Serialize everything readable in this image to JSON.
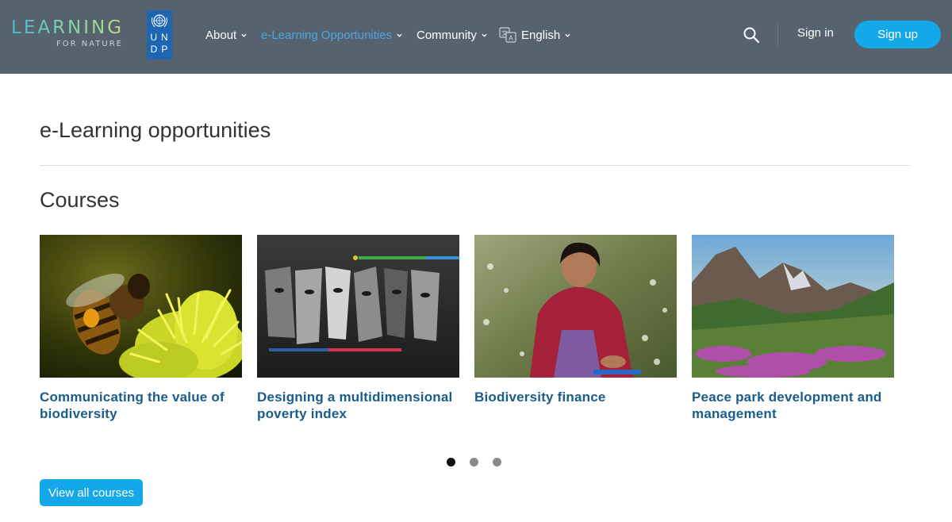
{
  "header": {
    "logo_main": "LEARNING",
    "logo_sub": "FOR NATURE",
    "partner_letters": [
      "U",
      "N",
      "D",
      "P"
    ],
    "nav": [
      {
        "label": "About"
      },
      {
        "label": "e-Learning Opportunities",
        "active": true
      },
      {
        "label": "Community"
      },
      {
        "label": "English"
      }
    ],
    "sign_in": "Sign in",
    "sign_up": "Sign up",
    "colors": {
      "bar": "#56636f",
      "accent": "#14a8e8",
      "active_nav": "#4da6e0"
    }
  },
  "main": {
    "page_title": "e-Learning opportunities",
    "section_title": "Courses",
    "courses": [
      {
        "title": "Communicating the value of biodiversity",
        "image": "bee-on-flower"
      },
      {
        "title": "Designing a multidimensional poverty index",
        "image": "faces-collage"
      },
      {
        "title": "Biodiversity finance",
        "image": "woman-gathering-plants"
      },
      {
        "title": "Peace park development and management",
        "image": "mountain-meadow"
      }
    ],
    "carousel": {
      "pages": 3,
      "current": 1
    },
    "view_all": "View all courses"
  }
}
